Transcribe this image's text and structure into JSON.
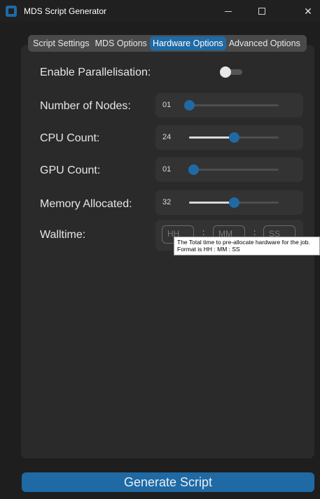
{
  "window": {
    "title": "MDS Script Generator",
    "icon": "app-icon",
    "controls": {
      "minimize": "minimize-icon",
      "maximize": "maximize-icon",
      "close": "✕"
    }
  },
  "tabs": [
    {
      "label": "Script Settings",
      "active": false
    },
    {
      "label": "MDS Options",
      "active": false
    },
    {
      "label": "Hardware Options",
      "active": true
    },
    {
      "label": "Advanced Options",
      "active": false
    }
  ],
  "hardware": {
    "parallelisation": {
      "label": "Enable Parallelisation:",
      "enabled": false
    },
    "nodes": {
      "label": "Number of Nodes:",
      "value": "01",
      "slider_fraction": 0.0
    },
    "cpu": {
      "label": "CPU Count:",
      "value": "24",
      "slider_fraction": 0.5
    },
    "gpu": {
      "label": "GPU Count:",
      "value": "01",
      "slider_fraction": 0.05
    },
    "memory": {
      "label": "Memory Allocated:",
      "value": "32",
      "slider_fraction": 0.5
    },
    "walltime": {
      "label": "Walltime:",
      "hh_placeholder": "HH",
      "mm_placeholder": "MM",
      "ss_placeholder": "SS",
      "separator": ":"
    }
  },
  "tooltip": {
    "line1": "The Total time to pre-allocate hardware for the job.",
    "line2": "Format is HH : MM : SS"
  },
  "generate_button": {
    "label": "Generate Script"
  },
  "colors": {
    "accent": "#1f6aa5",
    "background": "#1e1e1e",
    "panel": "#2a2a2a",
    "field": "#333333"
  }
}
